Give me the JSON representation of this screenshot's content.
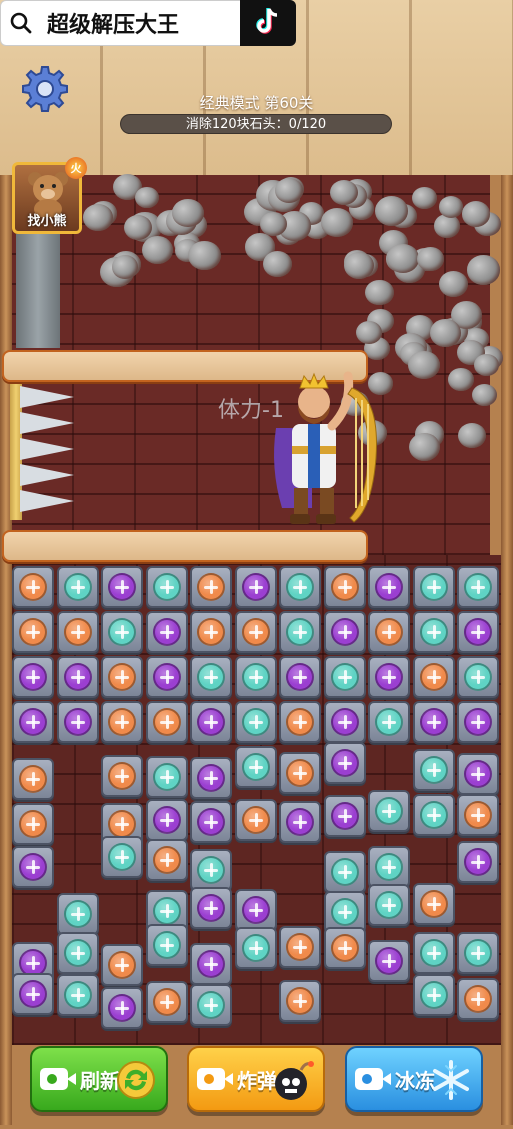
{
  "search": {
    "query": "超级解压大王"
  },
  "level": {
    "title": "经典模式 第60关",
    "progress_text": "消除120块石头：0/120",
    "progress_value": 0,
    "progress_max": 120
  },
  "bear_card": {
    "label": "找小熊",
    "badge": "火"
  },
  "stamina_text": "体力-1",
  "actions": {
    "refresh": "刷新",
    "bomb": "炸弹",
    "freeze": "冰冻"
  },
  "colors": {
    "orange": "#f08a4b",
    "teal": "#5fd3c4",
    "purple": "#9b3fd1"
  },
  "icons": [
    "search-icon",
    "tiktok-icon",
    "gear-icon",
    "bear-icon",
    "video-icon",
    "refresh-icon",
    "bomb-icon",
    "snowflake-icon"
  ],
  "tiles": {
    "top_rows": [
      [
        "orange",
        "teal",
        "purple",
        "teal",
        "orange",
        "purple",
        "teal",
        "orange",
        "purple",
        "teal",
        "teal"
      ],
      [
        "orange",
        "orange",
        "teal",
        "purple",
        "orange",
        "orange",
        "teal",
        "purple",
        "orange",
        "teal",
        "purple"
      ],
      [
        "purple",
        "purple",
        "orange",
        "purple",
        "teal",
        "teal",
        "purple",
        "teal",
        "purple",
        "orange",
        "teal"
      ],
      [
        "purple",
        "purple",
        "orange",
        "orange",
        "purple",
        "teal",
        "orange",
        "purple",
        "teal",
        "purple",
        "purple"
      ]
    ]
  }
}
